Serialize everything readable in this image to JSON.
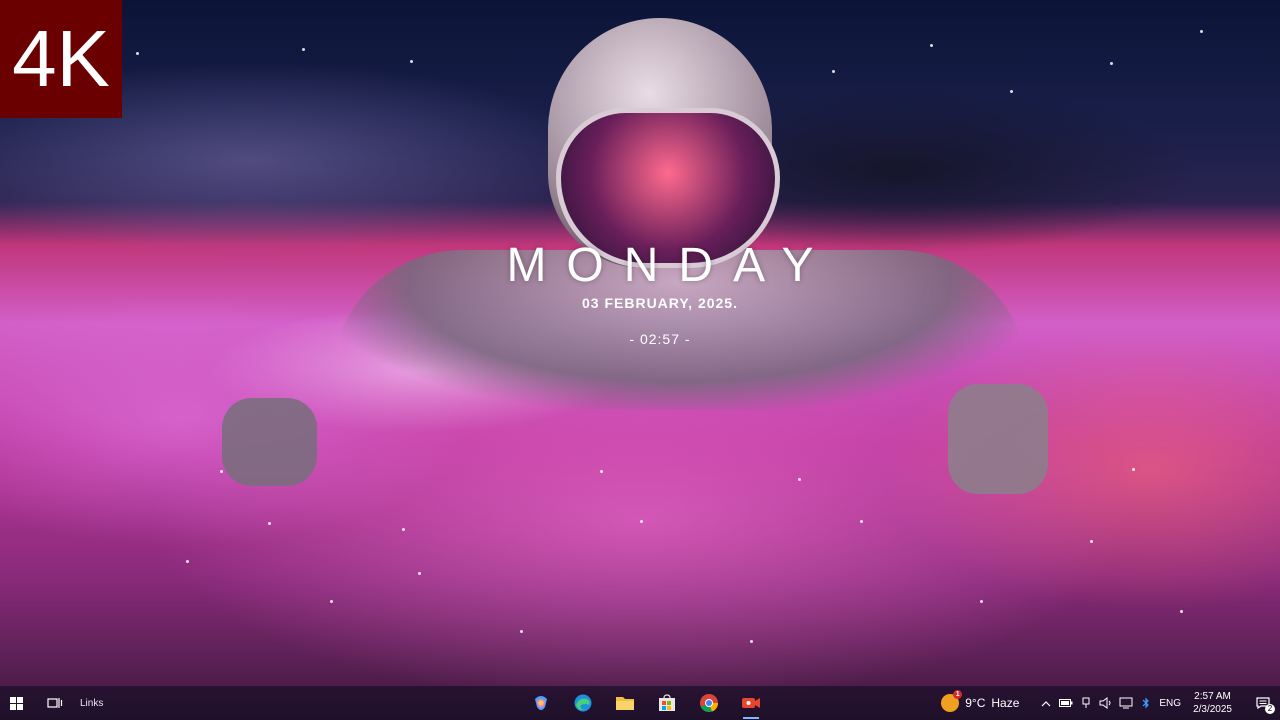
{
  "badge": {
    "text": "4K"
  },
  "widget": {
    "day": "MONDAY",
    "date": "03 FEBRUARY, 2025.",
    "time": "- 02:57 -"
  },
  "taskbar": {
    "start_icon": "windows-logo-icon",
    "taskview_icon": "task-view-icon",
    "links_label": "Links",
    "apps": [
      {
        "name": "copilot",
        "icon": "copilot-icon"
      },
      {
        "name": "edge",
        "icon": "edge-browser-icon"
      },
      {
        "name": "file-explorer",
        "icon": "folder-icon"
      },
      {
        "name": "store",
        "icon": "store-icon"
      },
      {
        "name": "chrome",
        "icon": "chrome-icon"
      },
      {
        "name": "recorder",
        "icon": "video-camera-icon"
      }
    ],
    "weather": {
      "temp": "9°C",
      "condition": "Haze",
      "alert_count": "1"
    },
    "tray_icons": [
      "chevron-up-icon",
      "battery-icon",
      "usb-icon",
      "volume-icon",
      "network-icon",
      "bluetooth-icon"
    ],
    "language": "ENG",
    "clock": {
      "time": "2:57 AM",
      "date": "2/3/2025"
    },
    "notification_count": "2"
  },
  "colors": {
    "badge_bg": "#6b0000",
    "taskbar_bg": "rgba(10,10,30,0.55)",
    "active_indicator": "#7fb6ff"
  }
}
